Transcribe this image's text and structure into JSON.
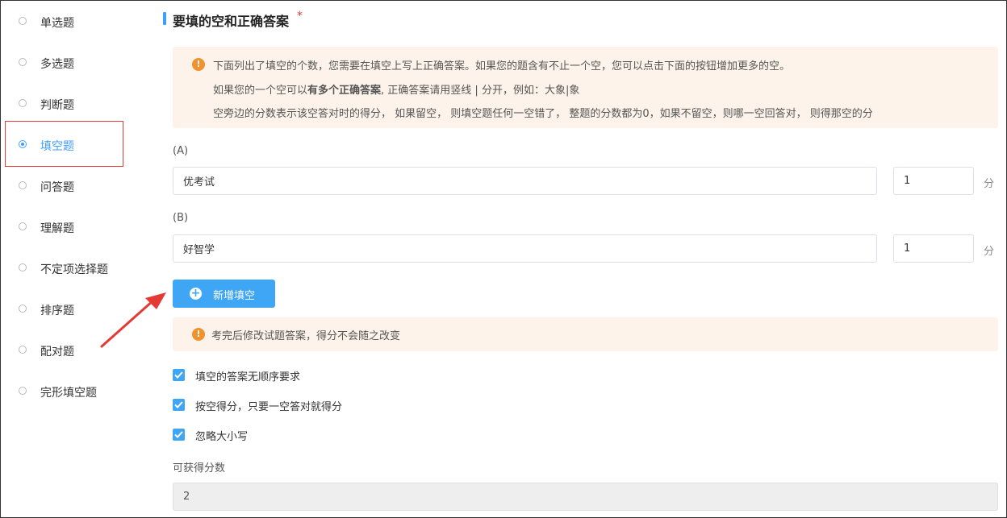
{
  "question_types": [
    {
      "label": "单选题",
      "selected": false
    },
    {
      "label": "多选题",
      "selected": false
    },
    {
      "label": "判断题",
      "selected": false
    },
    {
      "label": "填空题",
      "selected": true
    },
    {
      "label": "问答题",
      "selected": false
    },
    {
      "label": "理解题",
      "selected": false
    },
    {
      "label": "不定项选择题",
      "selected": false
    },
    {
      "label": "排序题",
      "selected": false
    },
    {
      "label": "配对题",
      "selected": false
    },
    {
      "label": "完形填空题",
      "selected": false
    }
  ],
  "section": {
    "title": "要填的空和正确答案",
    "required_mark": "*"
  },
  "notice": {
    "line1": "下面列出了填空的个数，您需要在填空上写上正确答案。如果您的题含有不止一个空，您可以点击下面的按钮增加更多的空。",
    "line2_prefix": "如果您的一个空可以",
    "line2_bold": "有多个正确答案",
    "line2_suffix": ", 正确答案请用竖线 | 分开，例如：大象|象",
    "line3": "空旁边的分数表示该空答对时的得分， 如果留空， 则填空题任何一空错了， 整题的分数都为0，如果不留空，则哪一空回答对， 则得那空的分"
  },
  "blanks": [
    {
      "label": "(A)",
      "answer": "优考试",
      "score": "1",
      "unit": "分"
    },
    {
      "label": "(B)",
      "answer": "好智学",
      "score": "1",
      "unit": "分"
    }
  ],
  "add_button": {
    "label": "新增填空"
  },
  "notice2": {
    "text": "考完后修改试题答案，得分不会随之改变"
  },
  "options": [
    {
      "label": "填空的答案无顺序要求",
      "checked": true
    },
    {
      "label": "按空得分，只要一空答对就得分",
      "checked": true
    },
    {
      "label": "忽略大小写",
      "checked": true
    }
  ],
  "score_total": {
    "label": "可获得分数",
    "value": "2"
  },
  "colors": {
    "accent": "#409eff",
    "button": "#3ea6f5",
    "warning": "#f0922e",
    "notice_bg": "#fdf3ea",
    "highlight_box": "#e53935"
  }
}
